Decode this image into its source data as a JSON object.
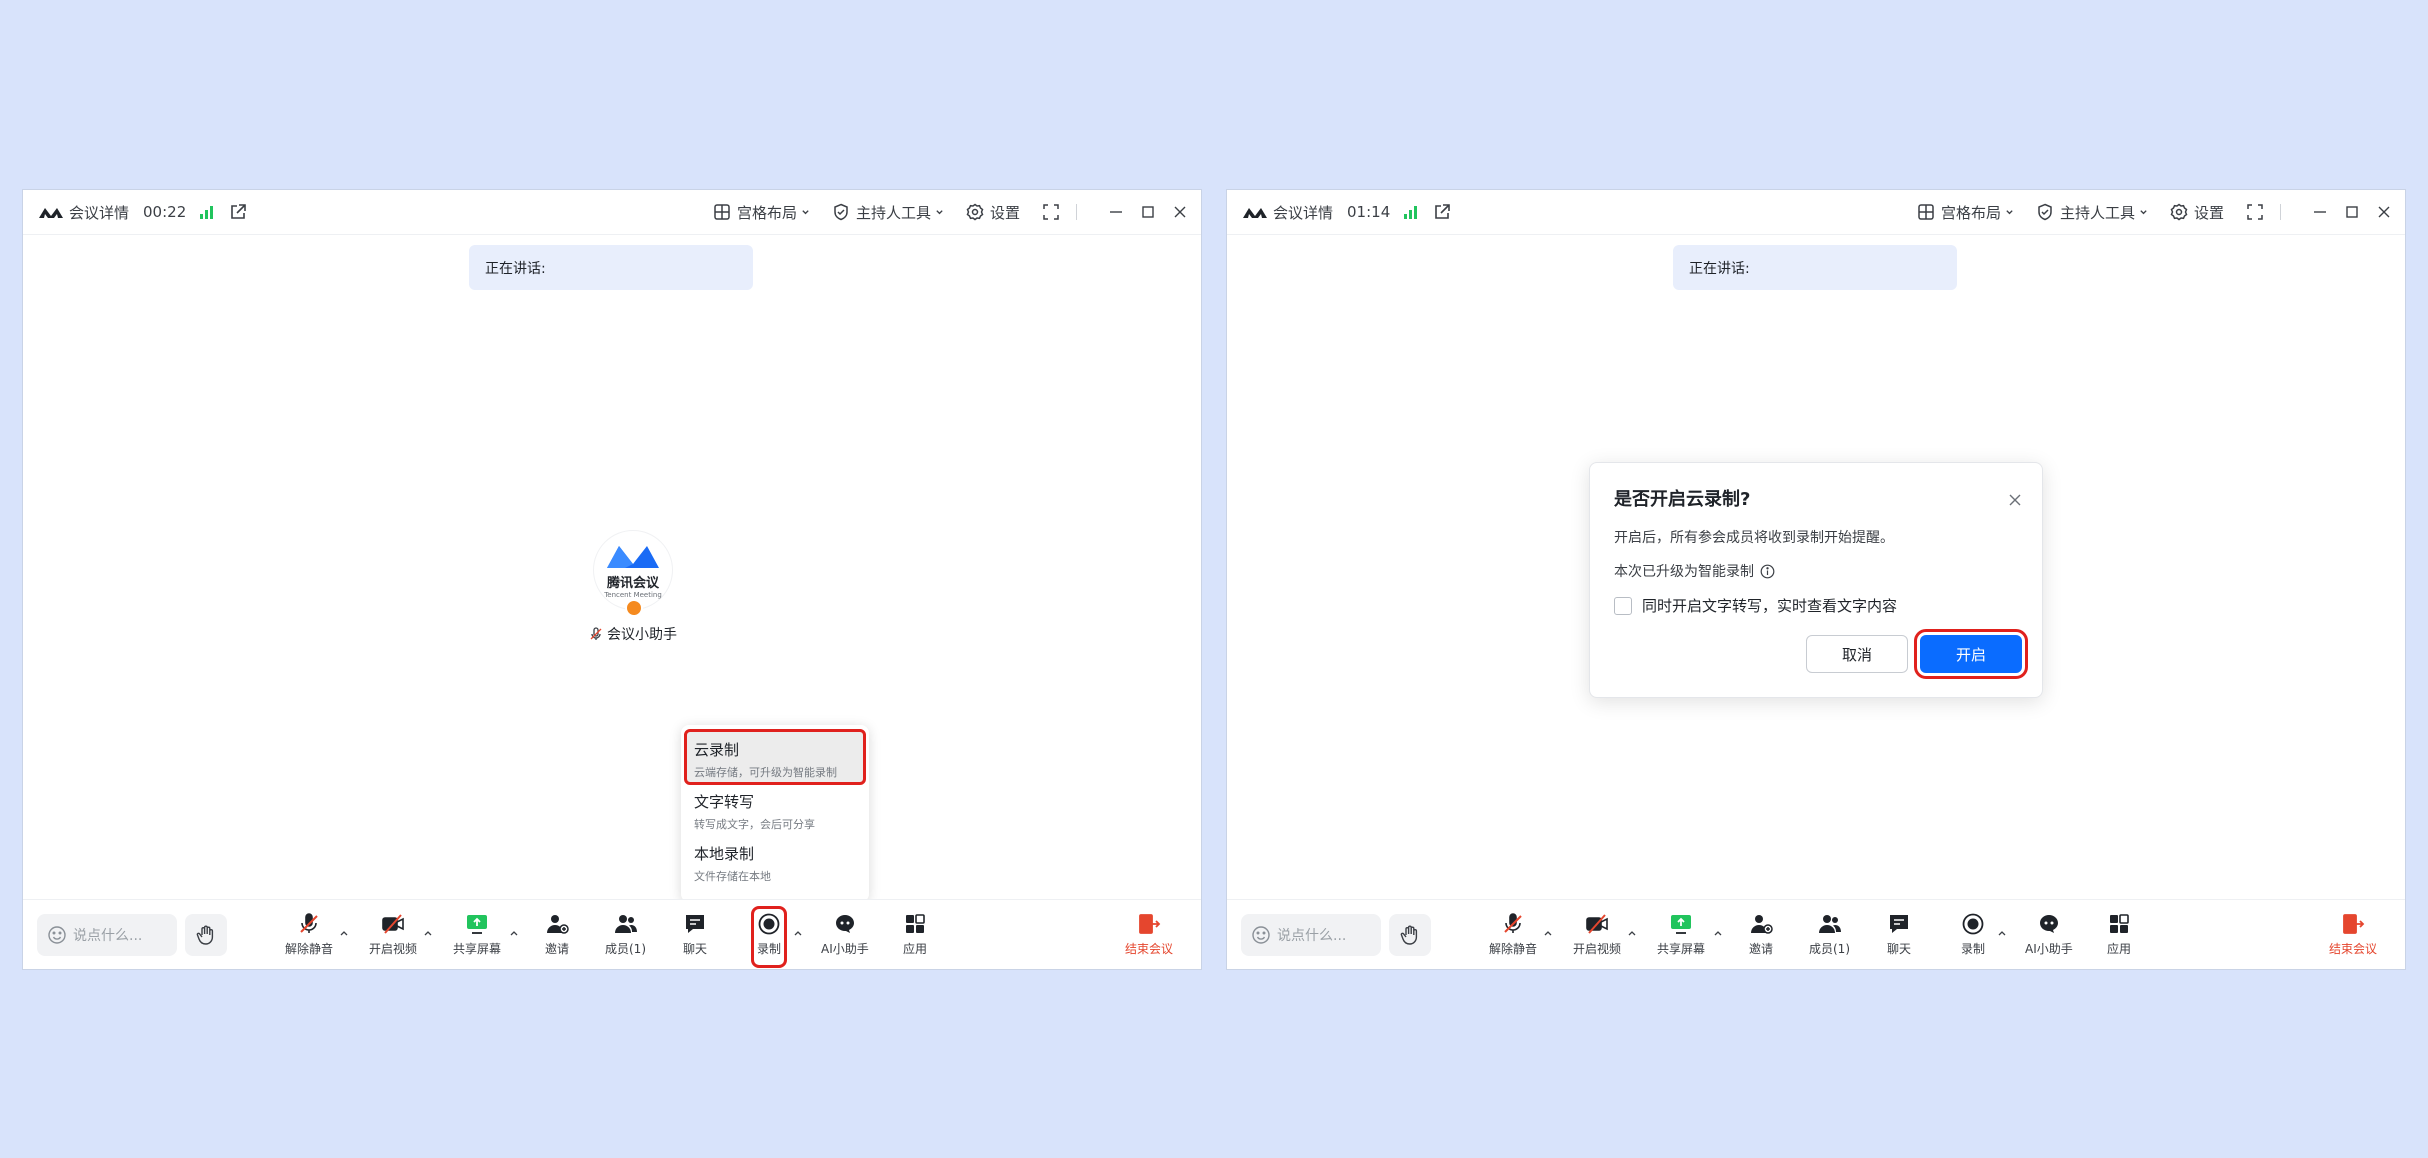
{
  "brand_color": "#0a6cff",
  "highlight_color": "#e0211d",
  "window_left": {
    "titlebar": {
      "meeting_info": "会议详情",
      "duration": "00:22",
      "layout": "宫格布局",
      "host_tools": "主持人工具",
      "settings": "设置"
    },
    "speaking_label": "正在讲话:",
    "participant": {
      "brand_text": "腾讯会议",
      "brand_sub": "Tencent Meeting",
      "name": "会议小助手"
    },
    "record_menu": [
      {
        "title": "云录制",
        "desc": "云端存储，可升级为智能录制"
      },
      {
        "title": "文字转写",
        "desc": "转写成文字，会后可分享"
      },
      {
        "title": "本地录制",
        "desc": "文件存储在本地"
      }
    ],
    "toolbar": {
      "chat_placeholder": "说点什么...",
      "unmute": "解除静音",
      "start_video": "开启视频",
      "share_screen": "共享屏幕",
      "invite": "邀请",
      "members": "成员(1)",
      "chat": "聊天",
      "record": "录制",
      "ai_assistant": "AI小助手",
      "apps": "应用",
      "end_meeting": "结束会议"
    }
  },
  "window_right": {
    "titlebar": {
      "meeting_info": "会议详情",
      "duration": "01:14",
      "layout": "宫格布局",
      "host_tools": "主持人工具",
      "settings": "设置"
    },
    "speaking_label": "正在讲话:",
    "dialog": {
      "title": "是否开启云录制?",
      "body": "开启后，所有参会成员将收到录制开始提醒。",
      "upgrade_note": "本次已升级为智能录制",
      "checkbox_label": "同时开启文字转写，实时查看文字内容",
      "checkbox_checked": false,
      "cancel": "取消",
      "confirm": "开启"
    },
    "toolbar": {
      "chat_placeholder": "说点什么...",
      "unmute": "解除静音",
      "start_video": "开启视频",
      "share_screen": "共享屏幕",
      "invite": "邀请",
      "members": "成员(1)",
      "chat": "聊天",
      "record": "录制",
      "ai_assistant": "AI小助手",
      "apps": "应用",
      "end_meeting": "结束会议"
    }
  }
}
